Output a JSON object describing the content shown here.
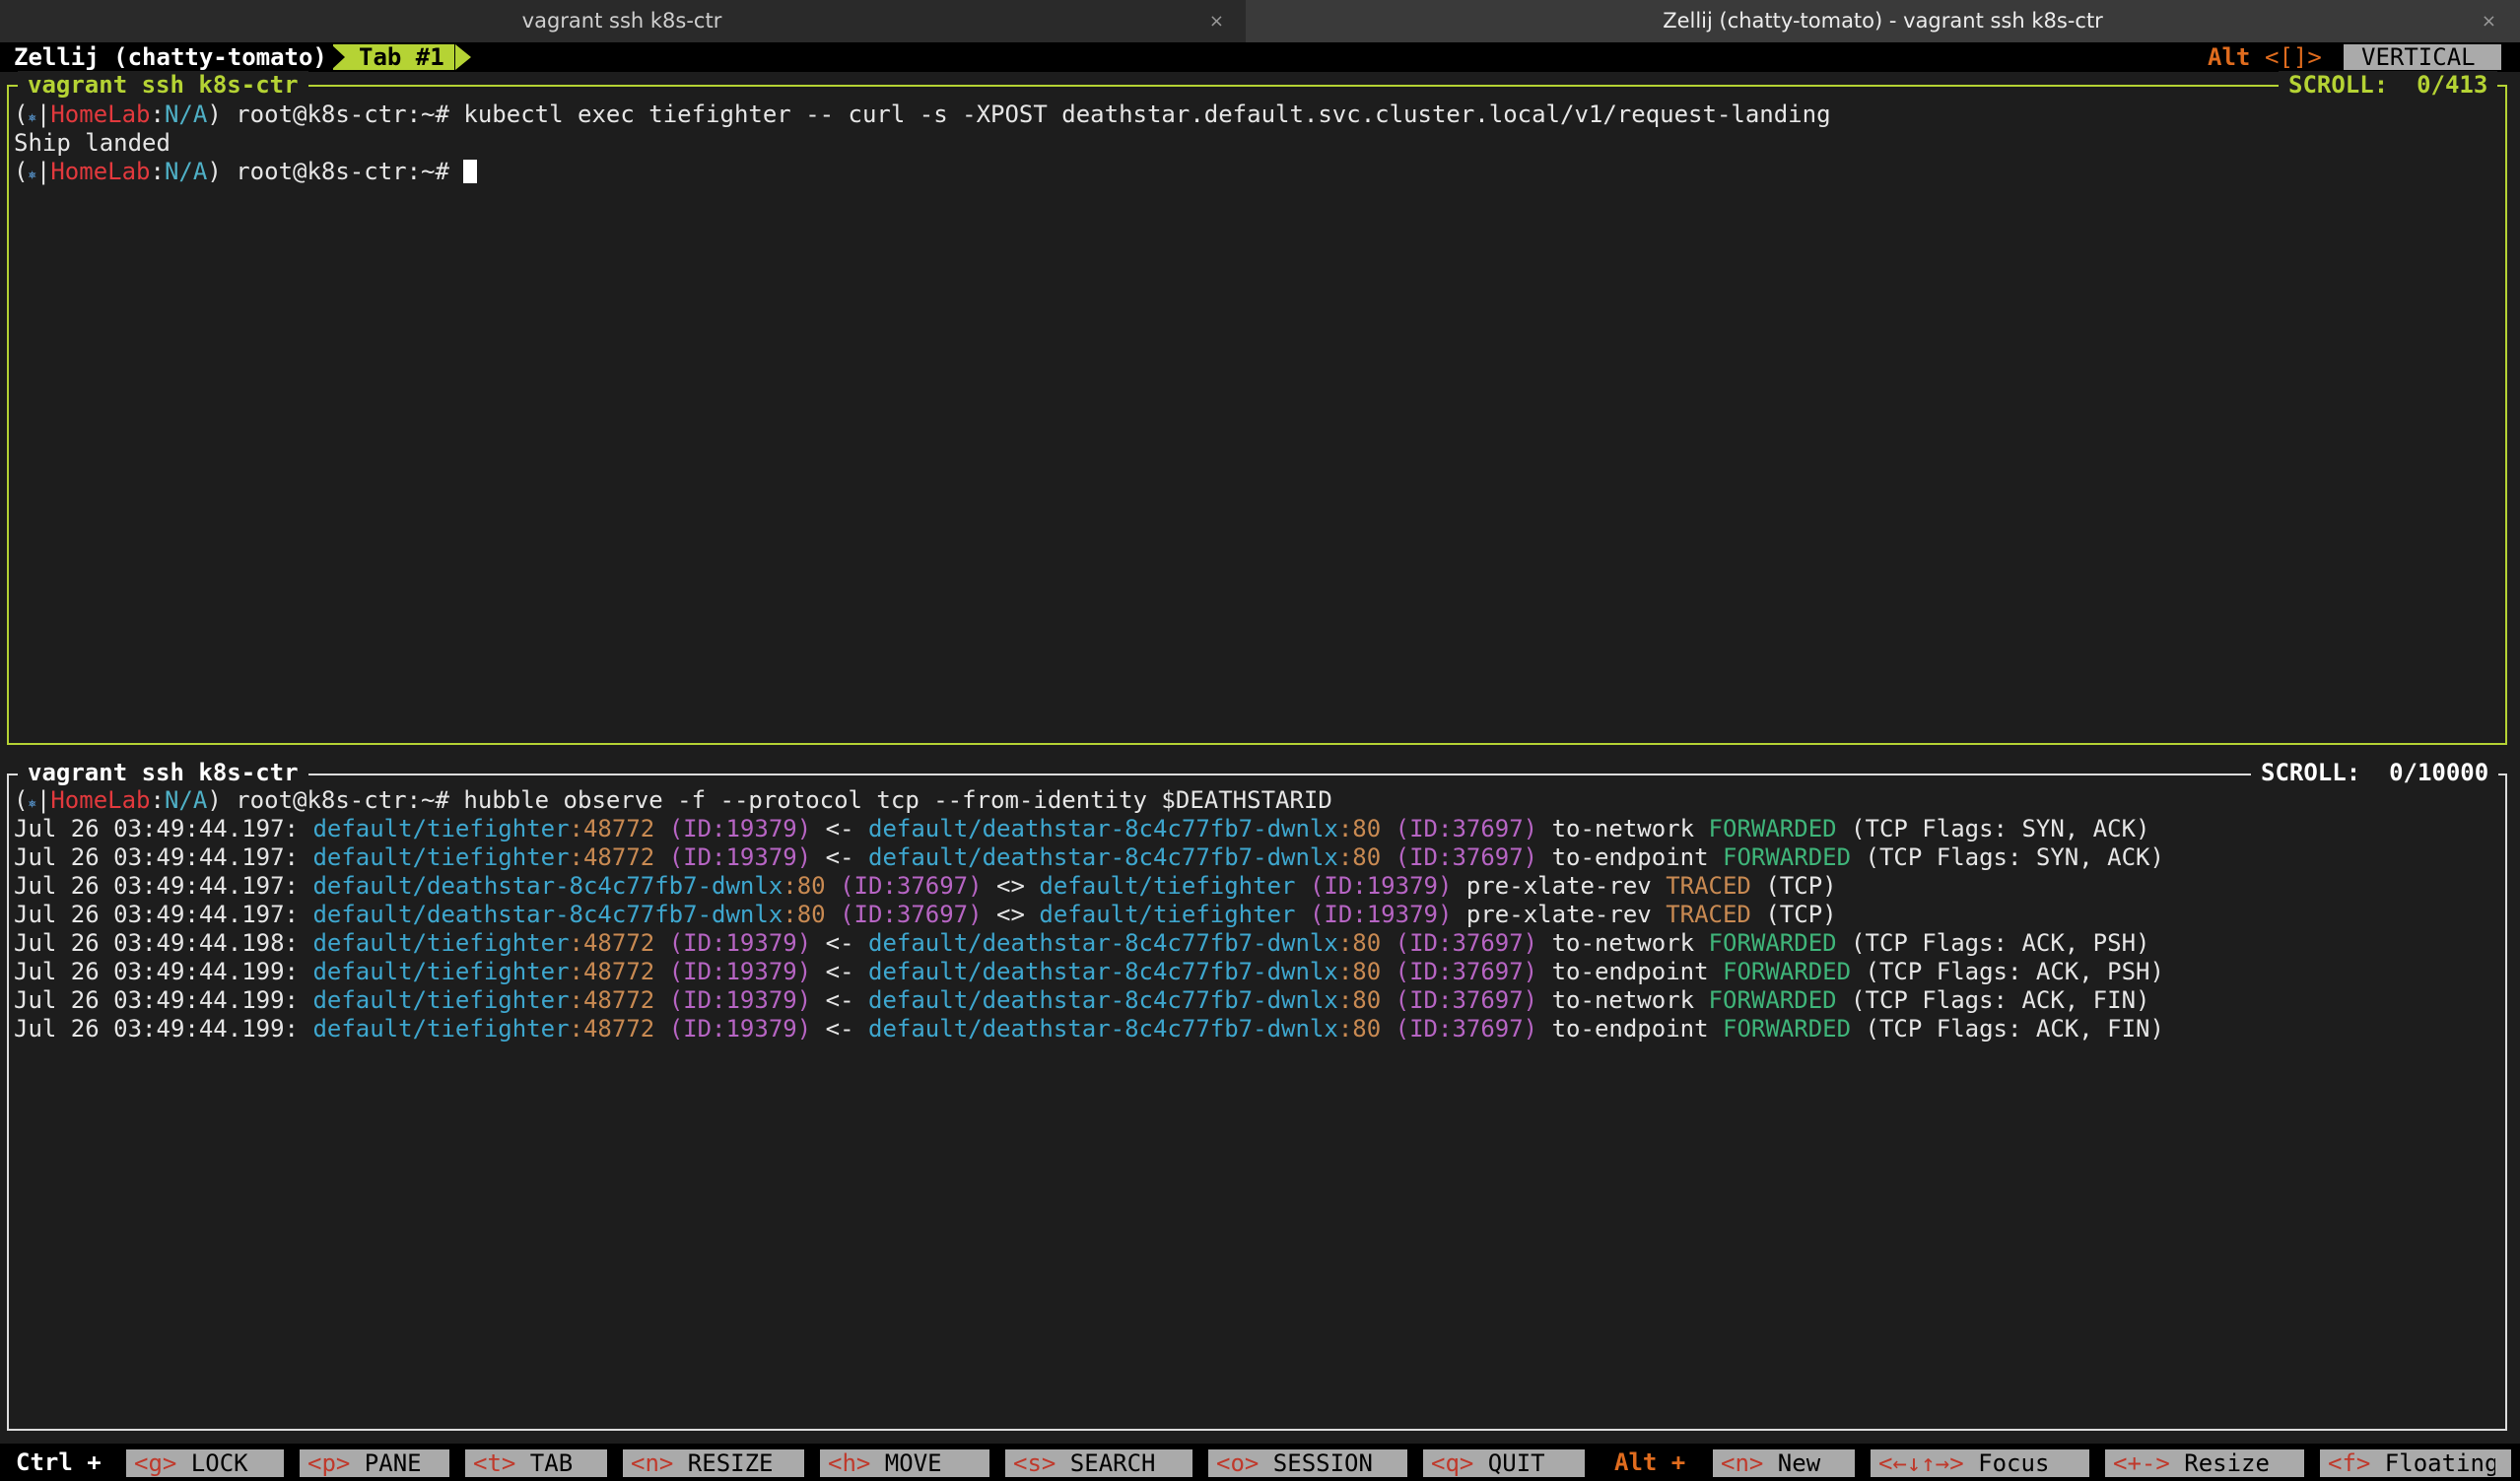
{
  "os_tabs": [
    {
      "label": "vagrant ssh k8s-ctr",
      "close": "×"
    },
    {
      "label": "Zellij (chatty-tomato) - vagrant ssh k8s-ctr",
      "close": "×"
    }
  ],
  "zellij_bar": {
    "session": "Zellij (chatty-tomato)",
    "tab": "Tab #1",
    "alt_label": "Alt",
    "alt_keys": "<[]>",
    "layout": "VERTICAL"
  },
  "pane_top": {
    "title": "vagrant ssh k8s-ctr",
    "scroll_label": "SCROLL:",
    "scroll_value": "0/413",
    "prompt_parts": {
      "open": "(",
      "icon": "⎈",
      "sep": "|",
      "context": "HomeLab",
      "colon": ":",
      "ns": "N/A",
      "close": ")",
      "user": " root@k8s-ctr:~# "
    },
    "command": "kubectl exec tiefighter -- curl -s -XPOST deathstar.default.svc.cluster.local/v1/request-landing",
    "output": "Ship landed"
  },
  "pane_bottom": {
    "title": "vagrant ssh k8s-ctr",
    "scroll_label": "SCROLL:",
    "scroll_value": "0/10000",
    "command": "hubble observe -f --protocol tcp --from-identity $DEATHSTARID",
    "flows": [
      {
        "time": "Jul 26 03:49:44.197:",
        "src": "default/tiefighter",
        "sport": ":48772",
        "sid": "(ID:19379)",
        "dir": "<-",
        "dst": "default/deathstar-8c4c77fb7-dwnlx",
        "dport": ":80",
        "did": "(ID:37697)",
        "obs": "to-network",
        "verdict": "FORWARDED",
        "flags": "(TCP Flags: SYN, ACK)"
      },
      {
        "time": "Jul 26 03:49:44.197:",
        "src": "default/tiefighter",
        "sport": ":48772",
        "sid": "(ID:19379)",
        "dir": "<-",
        "dst": "default/deathstar-8c4c77fb7-dwnlx",
        "dport": ":80",
        "did": "(ID:37697)",
        "obs": "to-endpoint",
        "verdict": "FORWARDED",
        "flags": "(TCP Flags: SYN, ACK)"
      },
      {
        "time": "Jul 26 03:49:44.197:",
        "src": "default/deathstar-8c4c77fb7-dwnlx",
        "sport": ":80",
        "sid": "(ID:37697)",
        "dir": "<>",
        "dst": "default/tiefighter",
        "dport": "",
        "did": "(ID:19379)",
        "obs": "pre-xlate-rev",
        "verdict": "TRACED",
        "flags": "(TCP)"
      },
      {
        "time": "Jul 26 03:49:44.197:",
        "src": "default/deathstar-8c4c77fb7-dwnlx",
        "sport": ":80",
        "sid": "(ID:37697)",
        "dir": "<>",
        "dst": "default/tiefighter",
        "dport": "",
        "did": "(ID:19379)",
        "obs": "pre-xlate-rev",
        "verdict": "TRACED",
        "flags": "(TCP)"
      },
      {
        "time": "Jul 26 03:49:44.198:",
        "src": "default/tiefighter",
        "sport": ":48772",
        "sid": "(ID:19379)",
        "dir": "<-",
        "dst": "default/deathstar-8c4c77fb7-dwnlx",
        "dport": ":80",
        "did": "(ID:37697)",
        "obs": "to-network",
        "verdict": "FORWARDED",
        "flags": "(TCP Flags: ACK, PSH)"
      },
      {
        "time": "Jul 26 03:49:44.199:",
        "src": "default/tiefighter",
        "sport": ":48772",
        "sid": "(ID:19379)",
        "dir": "<-",
        "dst": "default/deathstar-8c4c77fb7-dwnlx",
        "dport": ":80",
        "did": "(ID:37697)",
        "obs": "to-endpoint",
        "verdict": "FORWARDED",
        "flags": "(TCP Flags: ACK, PSH)"
      },
      {
        "time": "Jul 26 03:49:44.199:",
        "src": "default/tiefighter",
        "sport": ":48772",
        "sid": "(ID:19379)",
        "dir": "<-",
        "dst": "default/deathstar-8c4c77fb7-dwnlx",
        "dport": ":80",
        "did": "(ID:37697)",
        "obs": "to-network",
        "verdict": "FORWARDED",
        "flags": "(TCP Flags: ACK, FIN)"
      },
      {
        "time": "Jul 26 03:49:44.199:",
        "src": "default/tiefighter",
        "sport": ":48772",
        "sid": "(ID:19379)",
        "dir": "<-",
        "dst": "default/deathstar-8c4c77fb7-dwnlx",
        "dport": ":80",
        "did": "(ID:37697)",
        "obs": "to-endpoint",
        "verdict": "FORWARDED",
        "flags": "(TCP Flags: ACK, FIN)"
      }
    ]
  },
  "status_bar": {
    "ctrl": "Ctrl +",
    "ctrl_items": [
      {
        "key": "<g>",
        "label": " LOCK"
      },
      {
        "key": "<p>",
        "label": " PANE"
      },
      {
        "key": "<t>",
        "label": " TAB"
      },
      {
        "key": "<n>",
        "label": " RESIZE"
      },
      {
        "key": "<h>",
        "label": " MOVE"
      },
      {
        "key": "<s>",
        "label": " SEARCH"
      },
      {
        "key": "<o>",
        "label": " SESSION"
      },
      {
        "key": "<q>",
        "label": " QUIT"
      }
    ],
    "alt": "Alt +",
    "alt_items": [
      {
        "key": "<n>",
        "label": " New"
      },
      {
        "key": "<←↓↑→>",
        "label": " Focus"
      },
      {
        "key": "<+->",
        "label": " Resize"
      },
      {
        "key": "<f>",
        "label": " Floating"
      }
    ]
  },
  "colors": {
    "pane_active": "#b5d334",
    "pane_inactive": "#dcdcdc",
    "tab_active": "#b5d334",
    "alt_orange": "#e06c1e",
    "key_red": "#c0392b"
  }
}
